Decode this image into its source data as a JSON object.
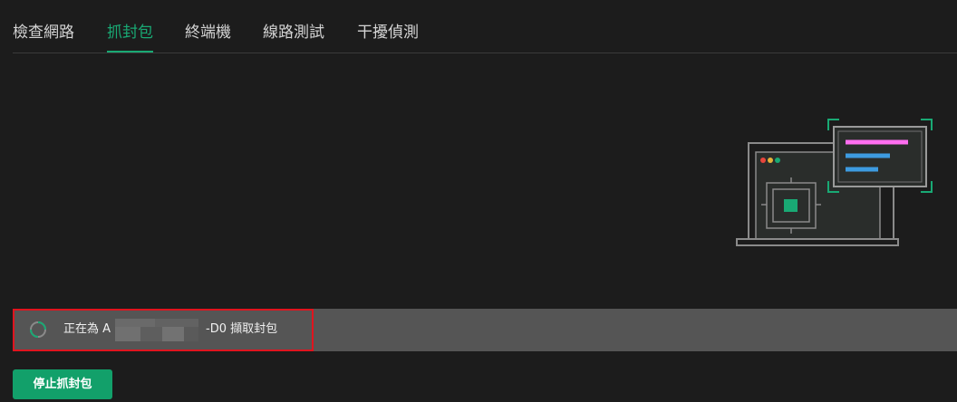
{
  "tabs": [
    {
      "label": "檢查網路",
      "active": false
    },
    {
      "label": "抓封包",
      "active": true
    },
    {
      "label": "終端機",
      "active": false
    },
    {
      "label": "線路測試",
      "active": false
    },
    {
      "label": "干擾偵測",
      "active": false
    }
  ],
  "status": {
    "prefix": "正在為 A",
    "suffix": "-D0 擷取封包",
    "spinner_icon": "loading-spinner-icon"
  },
  "stop_button": {
    "label": "停止抓封包"
  },
  "illustration": {
    "icon": "packet-capture-illustration",
    "colors": {
      "accent": "#19a974",
      "line_pink": "#ff6ef0",
      "line_blue": "#3d9be0",
      "dot_red": "#e8463c",
      "dot_yellow": "#e6b23a",
      "dot_green": "#19a974"
    }
  },
  "colors": {
    "background": "#1c1c1c",
    "accent": "#19a974",
    "status_bar": "#555555",
    "highlight_border": "#e0141e",
    "button": "#12a06a"
  }
}
